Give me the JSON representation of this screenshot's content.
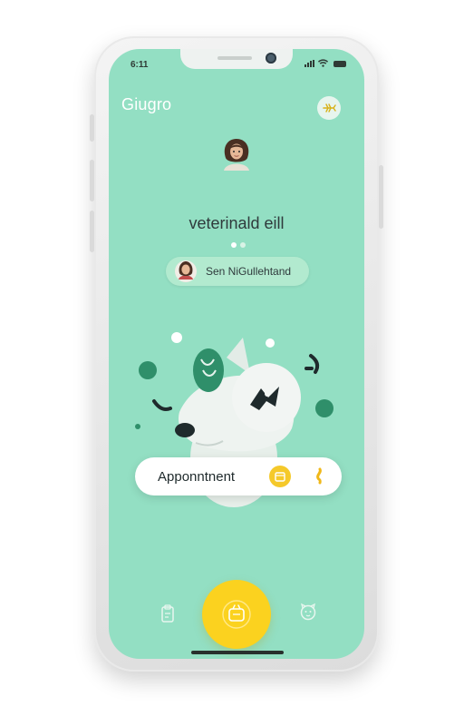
{
  "status_bar": {
    "time": "6:11"
  },
  "header": {
    "app_title": "Giugro"
  },
  "profile": {
    "title": "veterinald eill",
    "name_pill": "Sen NiGullehtand"
  },
  "appointment": {
    "label": "Apponntnent"
  },
  "colors": {
    "screen_bg": "#93dfc3",
    "accent_yellow": "#fbd21f",
    "dark_green": "#2f8f6a",
    "text_dark": "#2f3a3c"
  },
  "icons": {
    "top_right": "fish-bone-icon",
    "nav_left": "clipboard-icon",
    "nav_center": "pet-carrier-icon",
    "nav_right": "pet-face-icon"
  }
}
